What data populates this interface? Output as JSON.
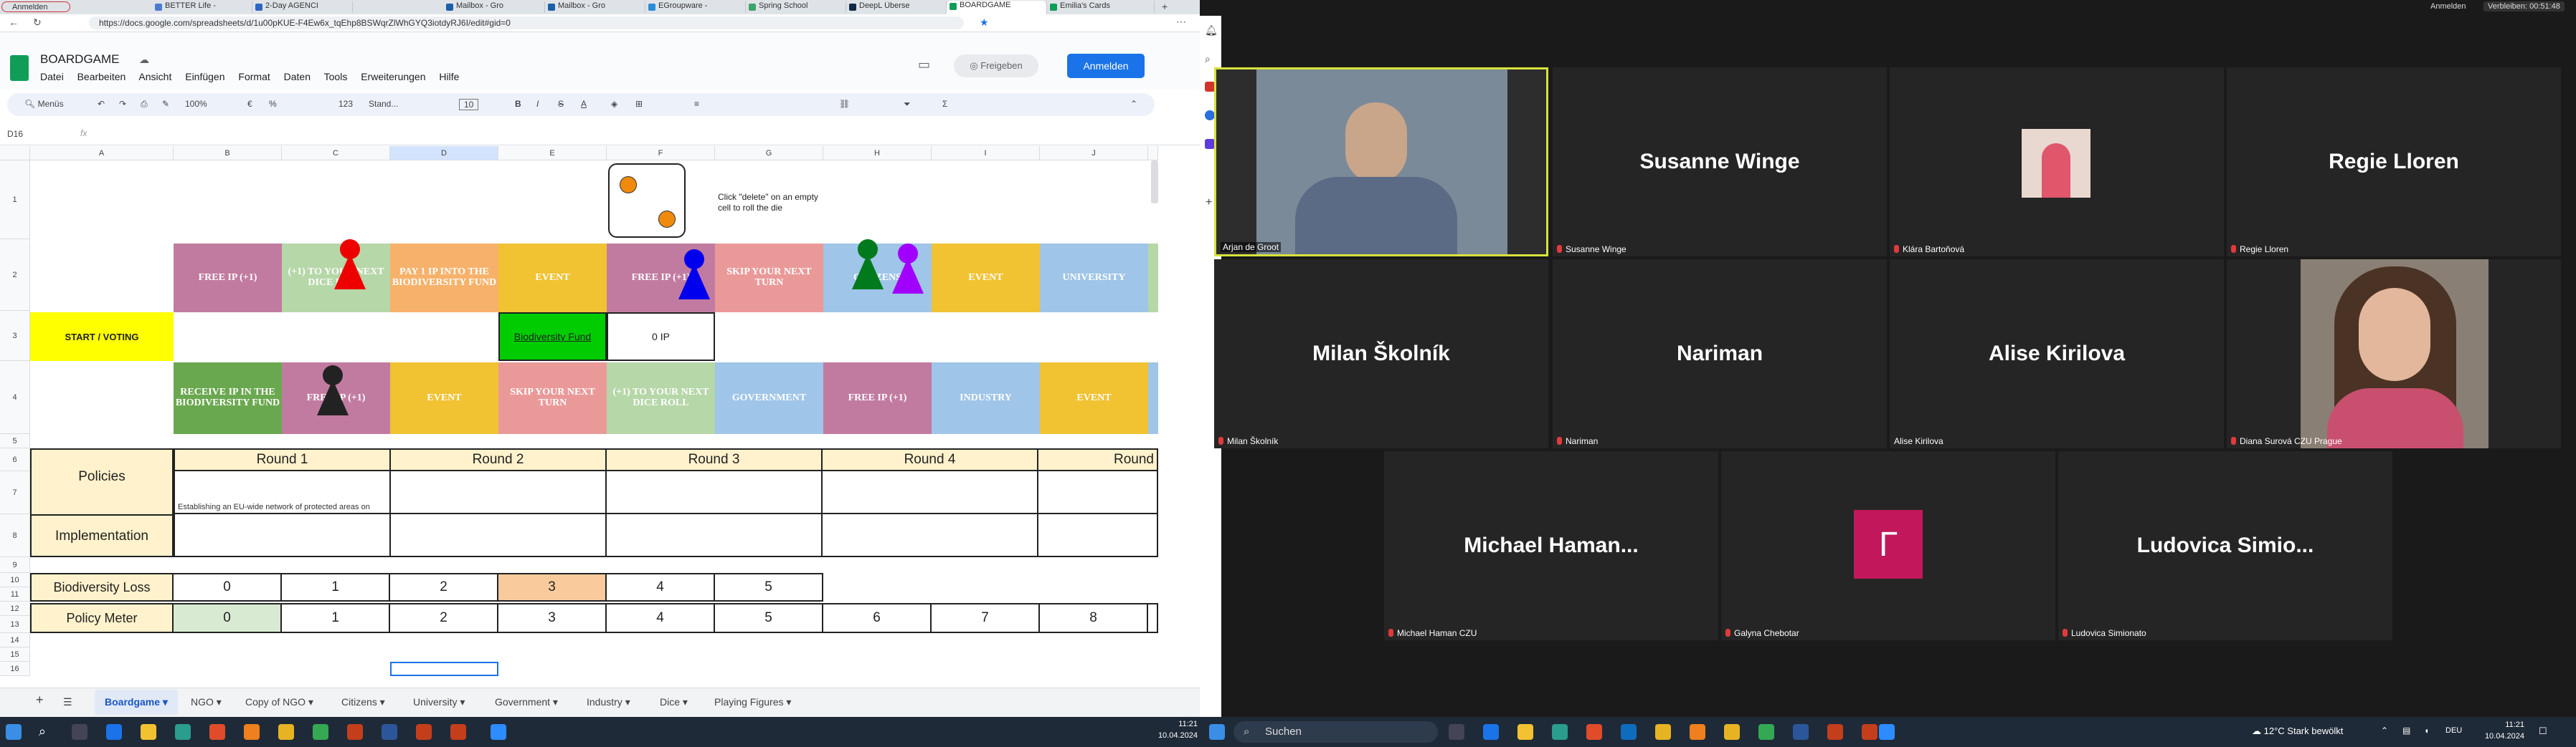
{
  "browser": {
    "profile_label": "Anmelden",
    "tabs": [
      {
        "label": "BETTER Life -"
      },
      {
        "label": "2-Day AGENCI"
      },
      {
        "label": "Mailbox - Gro"
      },
      {
        "label": "Mailbox - Gro"
      },
      {
        "label": "EGroupware -"
      },
      {
        "label": "Spring School"
      },
      {
        "label": "DeepL Überse"
      },
      {
        "label": "BOARDGAME"
      },
      {
        "label": "Emilia's Cards"
      }
    ],
    "url": "https://docs.google.com/spreadsheets/d/1u00pKUE-F4Ew6x_tqEhp8BSWqrZlWhGYQ3iotdyRJ6I/edit#gid=0"
  },
  "sheets": {
    "doc_title": "BOARDGAME",
    "menu": [
      "Datei",
      "Bearbeiten",
      "Ansicht",
      "Einfügen",
      "Format",
      "Daten",
      "Tools",
      "Erweiterungen",
      "Hilfe"
    ],
    "share_label": "Freigeben",
    "signin_label": "Anmelden",
    "toolbar": {
      "search": "Menüs",
      "zoom": "100%",
      "currency": "€",
      "percent": "%",
      "format123": "123",
      "font": "Stand...",
      "font_size": "10"
    },
    "cell_ref": "D16",
    "fx": "fx",
    "columns": [
      "A",
      "B",
      "C",
      "D",
      "E",
      "F",
      "G",
      "H",
      "I",
      "J"
    ],
    "rows": [
      "1",
      "2",
      "3",
      "4",
      "5",
      "6",
      "7",
      "8",
      "9",
      "10",
      "11",
      "12",
      "13",
      "14",
      "15",
      "16"
    ],
    "dice_instruction": "Click \"delete\" on an empty cell to roll the die",
    "row2": [
      "FREE IP (+1)",
      "(+1) TO YOUR NEXT DICE ROLL",
      "PAY 1 IP INTO THE BIODIVERSITY FUND",
      "EVENT",
      "FREE IP (+1)",
      "SKIP YOUR NEXT TURN",
      "CITIZENS",
      "EVENT",
      "UNIVERSITY"
    ],
    "row3": {
      "start": "START / VOTING",
      "fund_label": "Biodiversity Fund",
      "fund_value": "0 IP"
    },
    "row4": [
      "RECEIVE IP IN THE BIODIVERSITY FUND",
      "FREE IP (+1)",
      "EVENT",
      "SKIP YOUR NEXT TURN",
      "(+1) TO YOUR NEXT DICE ROLL",
      "GOVERNMENT",
      "FREE IP (+1)",
      "INDUSTRY",
      "EVENT"
    ],
    "rounds": [
      "Round 1",
      "Round 2",
      "Round 3",
      "Round 4",
      "Round"
    ],
    "policies_label": "Policies",
    "policy_round1": "Establishing an EU-wide network of protected areas on",
    "implementation_label": "Implementation",
    "biodiversity_loss": {
      "label": "Biodiversity Loss",
      "values": [
        "0",
        "1",
        "2",
        "3",
        "4",
        "5"
      ]
    },
    "policy_meter": {
      "label": "Policy Meter",
      "values": [
        "0",
        "1",
        "2",
        "3",
        "4",
        "5",
        "6",
        "7",
        "8"
      ]
    },
    "sheet_tabs": [
      "Boardgame",
      "NGO",
      "Copy of NGO",
      "Citizens",
      "University",
      "Government",
      "Industry",
      "Dice",
      "Playing Figures"
    ]
  },
  "zoom": {
    "signin": "Anmelden",
    "timer": "Verbleiben: 00:51:48",
    "participants": [
      {
        "name": "Arjan de Groot",
        "display": ""
      },
      {
        "name": "Susanne Winge",
        "display": "Susanne Winge"
      },
      {
        "name": "Klára Bartoňová",
        "display": ""
      },
      {
        "name": "Regie Lloren",
        "display": "Regie Lloren"
      },
      {
        "name": "Milan Školník",
        "display": "Milan Školník"
      },
      {
        "name": "Nariman",
        "display": "Nariman"
      },
      {
        "name": "Alise Kirilova",
        "display": "Alise Kirilova"
      },
      {
        "name": "Diana Surová CZU Prague",
        "display": ""
      },
      {
        "name": "Michael Haman CZU",
        "display": "Michael  Haman..."
      },
      {
        "name": "Galyna Chebotar",
        "display": "Г"
      },
      {
        "name": "Ludovica Simionato",
        "display": "Ludovica  Simio..."
      }
    ]
  },
  "taskbar": {
    "search": "Suchen",
    "weather": "12°C  Stark bewölkt",
    "lang": "DEU",
    "time": "11:21",
    "date": "10.04.2024"
  }
}
